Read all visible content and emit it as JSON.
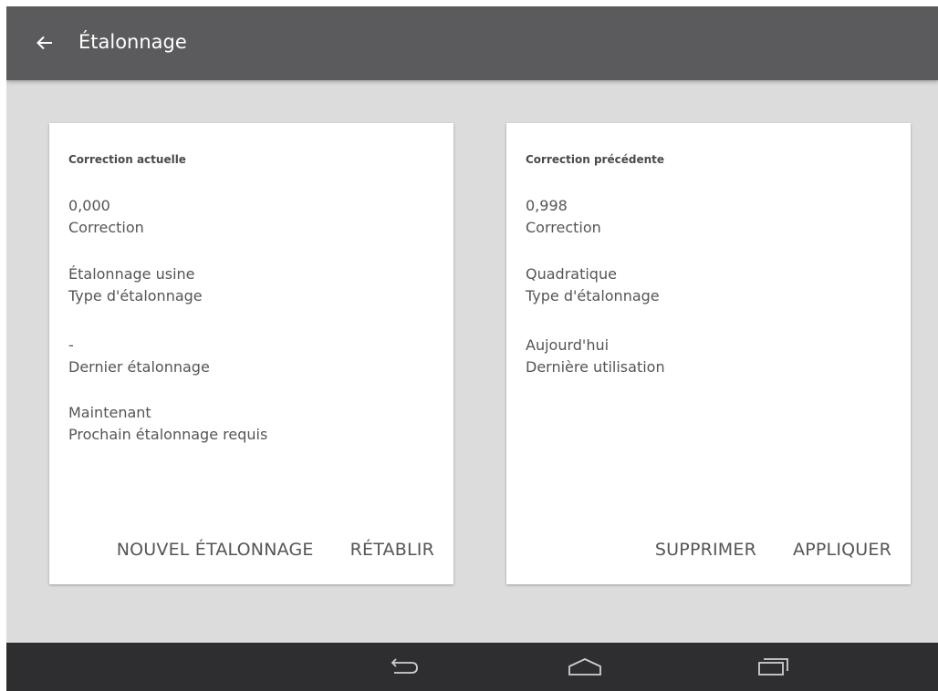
{
  "appbar": {
    "title": "Étalonnage",
    "back_icon": "arrow-left-icon"
  },
  "colors": {
    "appbar": "#5b5b5d",
    "background": "#dcdcdc",
    "card": "#ffffff",
    "navbar": "#2e2e30",
    "text": "#555555"
  },
  "current_card": {
    "heading": "Correction actuelle",
    "fields": [
      {
        "value": "0,000",
        "label": "Correction"
      },
      {
        "value": "Étalonnage usine",
        "label": "Type d'étalonnage"
      },
      {
        "value": "-",
        "label": "Dernier étalonnage"
      },
      {
        "value": "Maintenant",
        "label": "Prochain étalonnage requis"
      }
    ],
    "actions": [
      "NOUVEL ÉTALONNAGE",
      "RÉTABLIR"
    ]
  },
  "previous_card": {
    "heading": "Correction précédente",
    "fields": [
      {
        "value": "0,998",
        "label": "Correction"
      },
      {
        "value": "Quadratique",
        "label": "Type d'étalonnage"
      },
      {
        "value": "Aujourd'hui",
        "label": "Dernière utilisation"
      }
    ],
    "actions": [
      "SUPPRIMER",
      "APPLIQUER"
    ]
  },
  "navbar": {
    "icons": [
      "back-icon",
      "home-icon",
      "recent-apps-icon"
    ]
  }
}
